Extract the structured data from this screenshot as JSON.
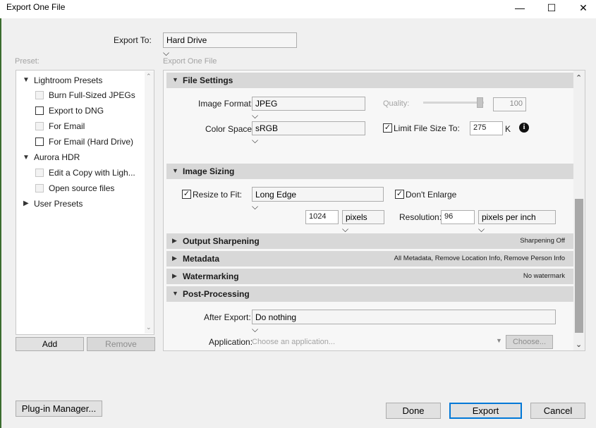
{
  "window": {
    "title": "Export One File",
    "minimize": "—",
    "maximize": "☐",
    "close": "✕"
  },
  "export_to": {
    "label": "Export To:",
    "value": "Hard Drive"
  },
  "preset": {
    "label": "Preset:",
    "groups": [
      {
        "name": "Lightroom Presets",
        "expanded": true,
        "items": [
          "Burn Full-Sized JPEGs",
          "Export to DNG",
          "For Email",
          "For Email (Hard Drive)"
        ]
      },
      {
        "name": "Aurora HDR",
        "expanded": true,
        "items": [
          "Edit a Copy with Ligh...",
          "Open source files"
        ]
      },
      {
        "name": "User Presets",
        "expanded": false,
        "items": []
      }
    ],
    "add_label": "Add",
    "remove_label": "Remove"
  },
  "panel_title": "Export One File",
  "file_settings": {
    "title": "File Settings",
    "image_format_label": "Image Format:",
    "image_format": "JPEG",
    "quality_label": "Quality:",
    "quality_value": "100",
    "quality_fraction": 1.0,
    "color_space_label": "Color Space:",
    "color_space": "sRGB",
    "limit_label": "Limit File Size To:",
    "limit_checked": true,
    "limit_value": "275",
    "limit_unit": "K",
    "info_icon": "info-icon"
  },
  "image_sizing": {
    "title": "Image Sizing",
    "resize_label": "Resize to Fit:",
    "resize_checked": true,
    "resize_mode": "Long Edge",
    "dont_enlarge_label": "Don't Enlarge",
    "dont_enlarge_checked": true,
    "size_value": "1024",
    "size_unit": "pixels",
    "resolution_label": "Resolution:",
    "resolution_value": "96",
    "resolution_unit": "pixels per inch"
  },
  "output_sharpening": {
    "title": "Output Sharpening",
    "summary": "Sharpening Off"
  },
  "metadata": {
    "title": "Metadata",
    "summary": "All Metadata, Remove Location Info, Remove Person Info"
  },
  "watermarking": {
    "title": "Watermarking",
    "summary": "No watermark"
  },
  "post_processing": {
    "title": "Post-Processing",
    "after_export_label": "After Export:",
    "after_export": "Do nothing",
    "application_label": "Application:",
    "application_placeholder": "Choose an application...",
    "choose_label": "Choose..."
  },
  "footer": {
    "plugin_manager": "Plug-in Manager...",
    "done": "Done",
    "export": "Export",
    "cancel": "Cancel"
  }
}
